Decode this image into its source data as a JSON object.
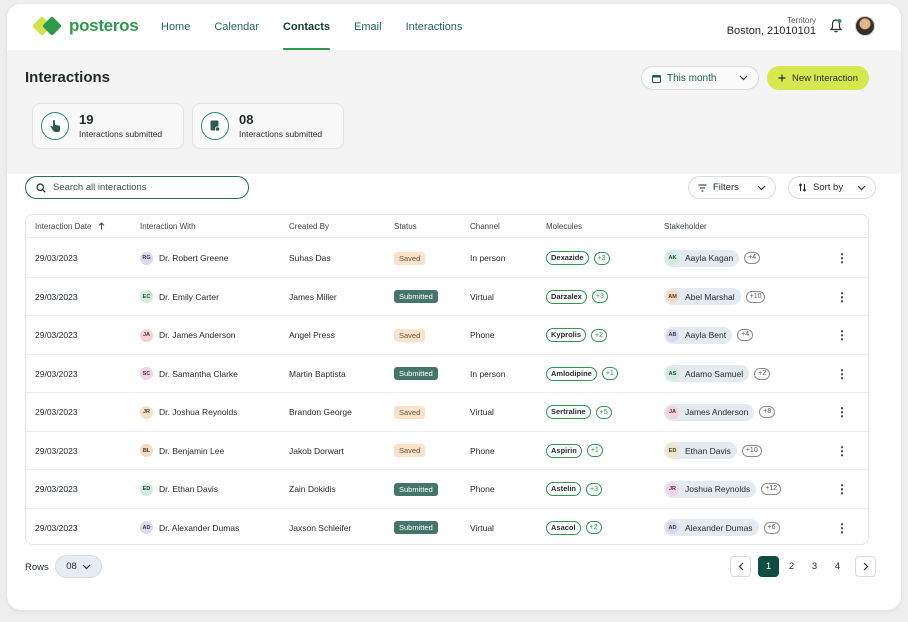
{
  "brand": {
    "name": "posteros"
  },
  "nav": {
    "items": [
      "Home",
      "Calendar",
      "Contacts",
      "Email",
      "Interactions"
    ],
    "active": "Contacts"
  },
  "territory": {
    "label": "Territory",
    "value": "Boston, 21010101"
  },
  "page": {
    "title": "Interactions"
  },
  "filters": {
    "month": "This month",
    "new_button": "New Interaction",
    "filters_label": "Filters",
    "sort_label": "Sort by"
  },
  "stats": [
    {
      "value": "19",
      "label": "Interactions submitted"
    },
    {
      "value": "08",
      "label": "Interactions submitted"
    }
  ],
  "search": {
    "placeholder": "Search all interactions"
  },
  "table": {
    "columns": [
      "Interaction Date",
      "Interaction With",
      "Created By",
      "Status",
      "Channel",
      "Molecules",
      "Stakeholder"
    ],
    "rows": [
      {
        "date": "29/03/2023",
        "with_initials": "RG",
        "with_color": "#dcd7f2",
        "with": "Dr. Robert Greene",
        "created_by": "Suhas Das",
        "status": "Saved",
        "channel": "In person",
        "molecule": "Dexazide",
        "mol_more": "+3",
        "sh_initials": "AK",
        "sh_color": "#cfeee0",
        "stakeholder": "Aayla Kagan",
        "sh_more": "+4"
      },
      {
        "date": "29/03/2023",
        "with_initials": "EC",
        "with_color": "#cfeee0",
        "with": "Dr. Emily Carter",
        "created_by": "James Miller",
        "status": "Submitted",
        "channel": "Virtual",
        "molecule": "Darzalex",
        "mol_more": "+3",
        "sh_initials": "AM",
        "sh_color": "#fbd9bf",
        "stakeholder": "Abel Marshal",
        "sh_more": "+10"
      },
      {
        "date": "29/03/2023",
        "with_initials": "JA",
        "with_color": "#f9d0d4",
        "with": "Dr. James Anderson",
        "created_by": "Angel Press",
        "status": "Saved",
        "channel": "Phone",
        "molecule": "Kyprolis",
        "mol_more": "+2",
        "sh_initials": "AB",
        "sh_color": "#dcd7f2",
        "stakeholder": "Aayla Bent",
        "sh_more": "+4"
      },
      {
        "date": "29/03/2023",
        "with_initials": "SC",
        "with_color": "#f4d2ec",
        "with": "Dr. Samantha Clarke",
        "created_by": "Martin Baptista",
        "status": "Submitted",
        "channel": "In person",
        "molecule": "Amlodipine",
        "mol_more": "+1",
        "sh_initials": "AS",
        "sh_color": "#cfeee0",
        "stakeholder": "Adamo Samuel",
        "sh_more": "+2"
      },
      {
        "date": "29/03/2023",
        "with_initials": "JR",
        "with_color": "#f3e3c4",
        "with": "Dr. Joshua Reynolds",
        "created_by": "Brandon George",
        "status": "Saved",
        "channel": "Virtual",
        "molecule": "Sertraline",
        "mol_more": "+5",
        "sh_initials": "JA",
        "sh_color": "#f9d0d4",
        "stakeholder": "James Anderson",
        "sh_more": "+8"
      },
      {
        "date": "29/03/2023",
        "with_initials": "BL",
        "with_color": "#fbd9bf",
        "with": "Dr. Benjamin Lee",
        "created_by": "Jakob Dorwart",
        "status": "Saved",
        "channel": "Phone",
        "molecule": "Aspirin",
        "mol_more": "+1",
        "sh_initials": "ED",
        "sh_color": "#f3e3c4",
        "stakeholder": "Ethan Davis",
        "sh_more": "+10"
      },
      {
        "date": "29/03/2023",
        "with_initials": "ED",
        "with_color": "#cfeee0",
        "with": "Dr. Ethan Davis",
        "created_by": "Zain Dokidis",
        "status": "Submitted",
        "channel": "Phone",
        "molecule": "Astelin",
        "mol_more": "+3",
        "sh_initials": "JR",
        "sh_color": "#f4d2ec",
        "stakeholder": "Joshua Reynolds",
        "sh_more": "+12"
      },
      {
        "date": "29/03/2023",
        "with_initials": "AD",
        "with_color": "#dcd7f2",
        "with": "Dr. Alexander Dumas",
        "created_by": "Jaxson Schleifer",
        "status": "Submitted",
        "channel": "Virtual",
        "molecule": "Asacol",
        "mol_more": "+2",
        "sh_initials": "AD",
        "sh_color": "#dcd7f2",
        "stakeholder": "Alexander Dumas",
        "sh_more": "+6"
      }
    ]
  },
  "footer": {
    "rows_label": "Rows",
    "rows_value": "08",
    "pages": [
      "1",
      "2",
      "3",
      "4"
    ],
    "current_page": "1"
  },
  "colors": {
    "brand_green": "#2e9a4c",
    "accent_lime": "#d6e84f",
    "dark_teal": "#0f4d42",
    "submitted": "#457569",
    "saved": "#fbe3cb"
  }
}
